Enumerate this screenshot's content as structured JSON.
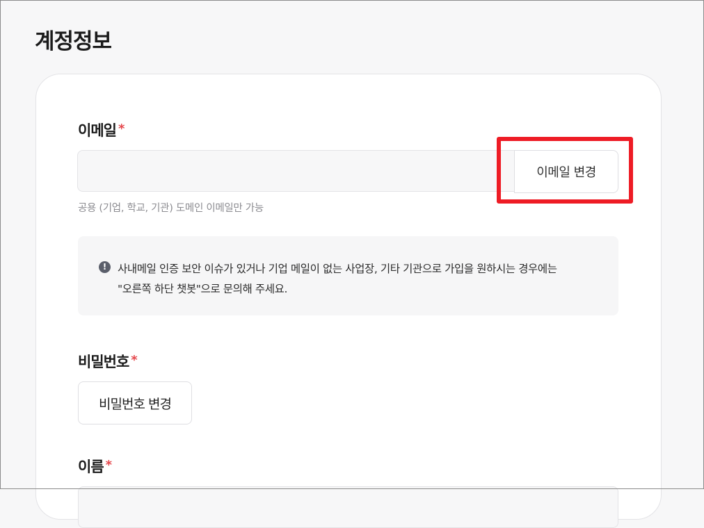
{
  "page": {
    "title": "계정정보"
  },
  "email": {
    "label": "이메일",
    "required_mark": "*",
    "value": "",
    "change_button": "이메일 변경",
    "helper_text": "공용 (기업, 학교, 기관) 도메인 이메일만 가능"
  },
  "notice": {
    "icon": "exclamation-circle-icon",
    "icon_glyph": "!",
    "line1": "사내메일 인증 보안 이슈가 있거나 기업 메일이 없는 사업장, 기타 기관으로 가입을 원하시는 경우에는",
    "line2": "\"오른쪽 하단 챗봇\"으로 문의해 주세요."
  },
  "password": {
    "label": "비밀번호",
    "required_mark": "*",
    "change_button": "비밀번호 변경"
  },
  "name": {
    "label": "이름",
    "required_mark": "*",
    "value": ""
  },
  "colors": {
    "required": "#e5484d",
    "highlight": "#ee1c25",
    "background": "#f7f7f8"
  }
}
